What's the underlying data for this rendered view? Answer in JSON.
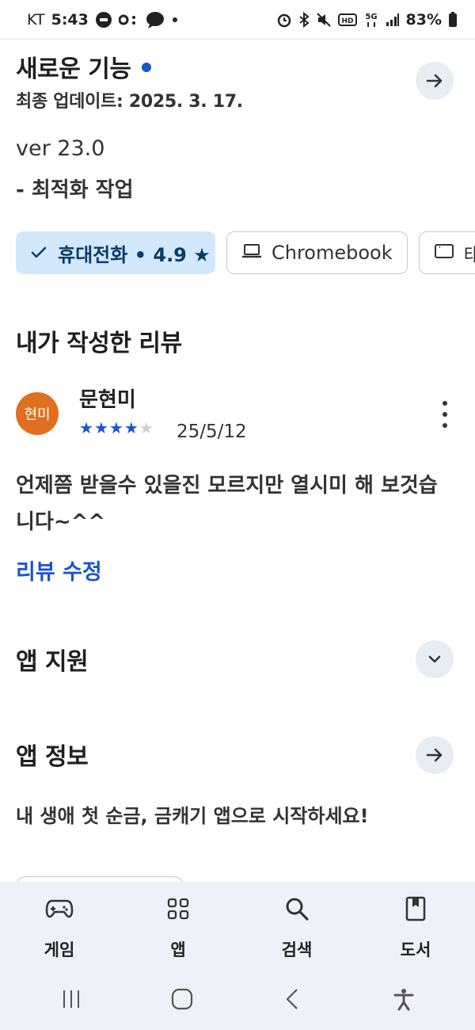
{
  "status_bar": {
    "carrier": "KT",
    "time": "5:43",
    "battery": "83%"
  },
  "whats_new": {
    "title": "새로운 기능",
    "last_updated": "최종 업데이트: 2025. 3. 17.",
    "version": "ver 23.0",
    "change": "- 최적화 작업"
  },
  "devices": [
    {
      "label": "휴대전화 • 4.9 ★",
      "selected": true,
      "icon": "check-icon"
    },
    {
      "label": "Chromebook",
      "selected": false,
      "icon": "laptop-icon"
    },
    {
      "label": "태",
      "selected": false,
      "icon": "tablet-icon"
    }
  ],
  "my_review": {
    "title": "내가 작성한 리뷰",
    "avatar_text": "현미",
    "avatar_color": "#e06f1f",
    "reviewer": "문현미",
    "rating": 4,
    "rating_max": 5,
    "date": "25/5/12",
    "text": "언제쯤 받을수 있을진 모르지만 열시미 해 보것습니다~^^",
    "edit_label": "리뷰 수정"
  },
  "app_support": {
    "title": "앱 지원"
  },
  "app_info": {
    "title": "앱 정보",
    "description": "내 생애 첫 순금, 금캐기 앱으로 시작하세요!"
  },
  "bottom_nav": [
    {
      "label": "게임",
      "icon": "gamepad-icon"
    },
    {
      "label": "앱",
      "icon": "apps-grid-icon"
    },
    {
      "label": "검색",
      "icon": "search-icon"
    },
    {
      "label": "도서",
      "icon": "book-icon"
    }
  ],
  "colors": {
    "accent": "#1a57c8",
    "chip_selected_bg": "#d3e8fb",
    "nav_bg": "#eef2f8"
  }
}
